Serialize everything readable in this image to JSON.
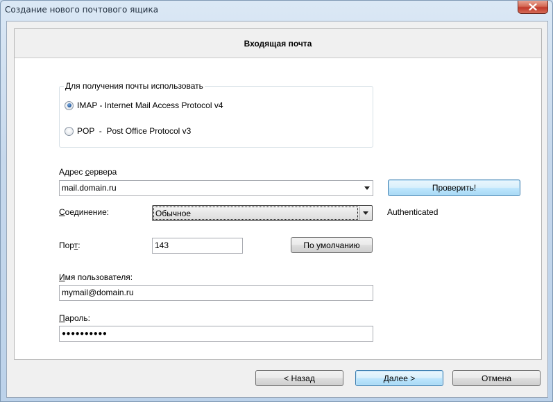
{
  "window": {
    "title": "Создание нового почтового ящика"
  },
  "header": {
    "title": "Входящая почта"
  },
  "receive": {
    "group_label": "Для получения почты использовать",
    "options": [
      {
        "label": "IMAP - Internet Mail Access Protocol v4",
        "checked": true
      },
      {
        "label": "POP  -  Post Office Protocol v3",
        "checked": false
      }
    ]
  },
  "server": {
    "label_prefix": "Адрес ",
    "label_underlined": "с",
    "label_suffix": "ервера",
    "value": "mail.domain.ru",
    "check_button": "Проверить!"
  },
  "connection": {
    "label_underlined": "С",
    "label_suffix": "оединение:",
    "value": "Обычное",
    "status": "Authenticated"
  },
  "port": {
    "label_prefix": "Пор",
    "label_underlined": "т",
    "label_suffix": ":",
    "value": "143",
    "default_button": "По умолчанию"
  },
  "username": {
    "label_underlined": "И",
    "label_suffix": "мя пользователя:",
    "value": "mymail@domain.ru"
  },
  "password": {
    "label_underlined": "П",
    "label_suffix": "ароль:",
    "value": "●●●●●●●●●●"
  },
  "footer": {
    "back_button": "<  Назад",
    "next_button": "Далее  >",
    "cancel_button": "Отмена"
  },
  "colors": {
    "close_button": "#c0392b",
    "focus_border": "#3c7fb1"
  }
}
